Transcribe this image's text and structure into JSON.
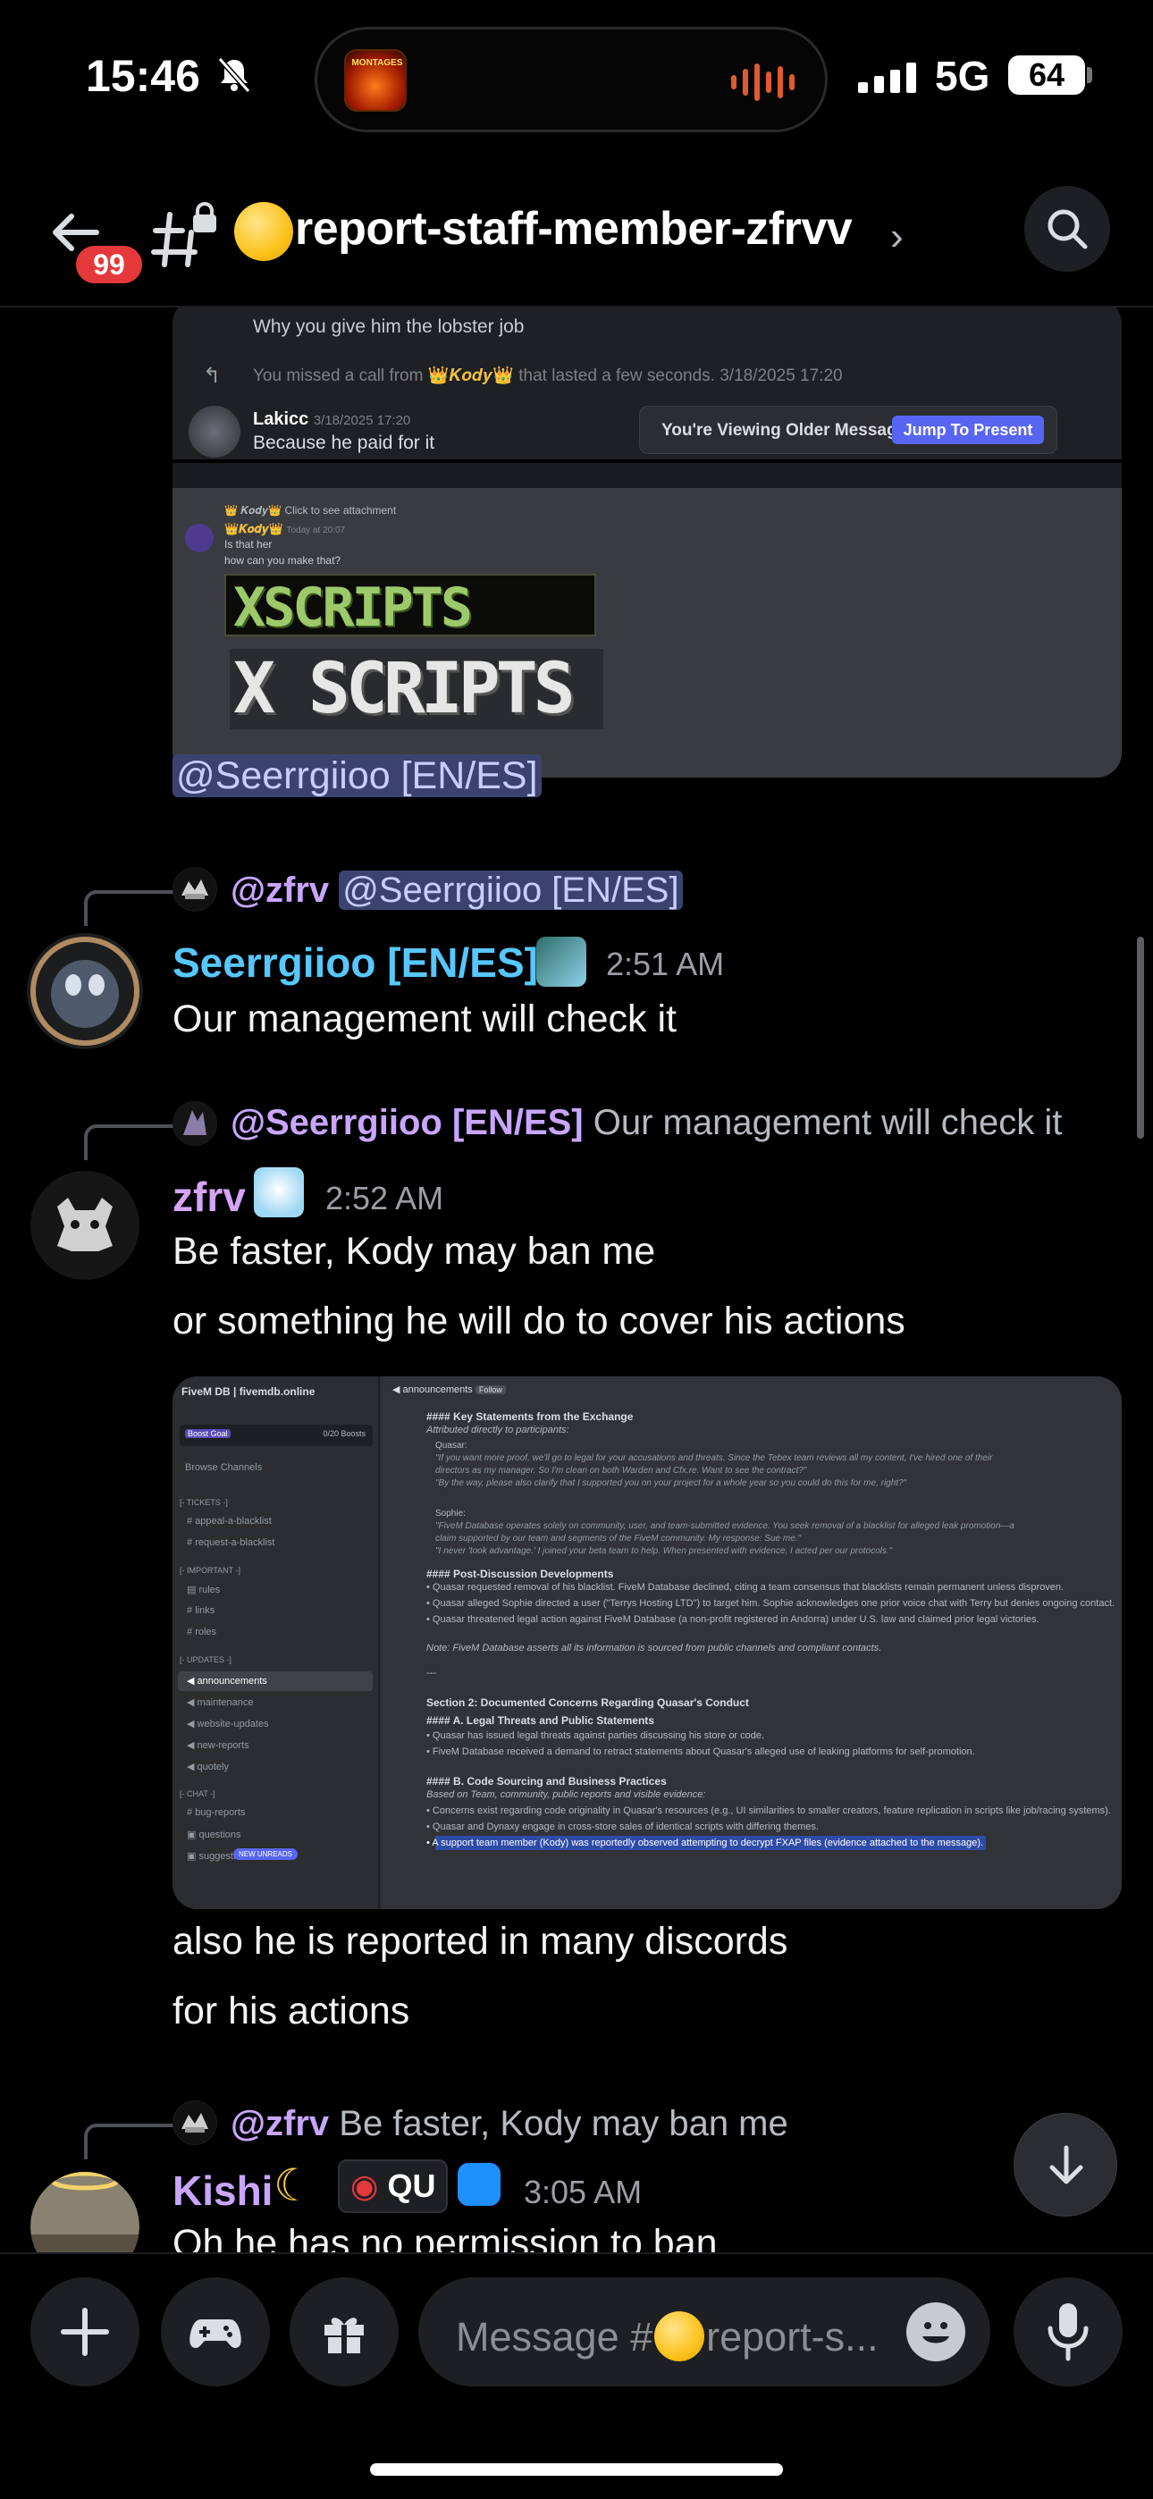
{
  "status_bar": {
    "time": "15:46",
    "network": "5G",
    "battery": "64",
    "island_app_label": "MONTAGES"
  },
  "header": {
    "back_badge": "99",
    "channel_name": "report-staff-member-zfrvv",
    "chevron": "›"
  },
  "attachment_1": {
    "line1": "Why you give him the lobster job",
    "missed_call_pre": "You missed a call from",
    "missed_call_user": "👑𝑲𝒐𝒅𝒚👑",
    "missed_call_post": "that lasted a few seconds. 3/18/2025 17:20",
    "user": "Lakicc",
    "user_time": "3/18/2025 17:20",
    "user_message": "Because he paid for it",
    "older_label": "You're Viewing Older Messages",
    "jump_label": "Jump To Present",
    "reply_header": "👑 𝑲𝒐𝒅𝒚👑 Click to see attachment",
    "kody_name": "👑𝑲𝒐𝒅𝒚👑",
    "kody_time": "Today at 20:07",
    "kody_line1": "Is that her",
    "kody_line2": "how can you make that?",
    "banner1": "XSCRIPTS",
    "banner2": "X SCRIPTS"
  },
  "mention_line": "@Seerrgiioo [EN/ES]",
  "messages": [
    {
      "reply_to_user": "@zfrv",
      "reply_to_text": "@Seerrgiioo [EN/ES]",
      "username": "Seerrgiioo [EN/ES]",
      "username_color": "#57c7ff",
      "time": "2:51 AM",
      "lines": [
        "Our management will check it"
      ]
    },
    {
      "reply_to_user": "@Seerrgiioo [EN/ES]",
      "reply_to_text": "Our management will check it",
      "username": "zfrv",
      "username_color": "#d6a5f5",
      "time": "2:52 AM",
      "lines": [
        "Be faster, Kody may ban me",
        "or something he will do to cover his actions"
      ],
      "after_lines": [
        "also he is reported in many discords",
        "for his actions"
      ]
    },
    {
      "reply_to_user": "@zfrv",
      "reply_to_text": "Be faster, Kody may ban me",
      "username": "Kishi",
      "username_color": "#c8a6ff",
      "tag": "QU",
      "time": "3:05 AM",
      "lines": [
        "Oh he has no permission to ban"
      ]
    }
  ],
  "attachment_2": {
    "server_name": "FiveM DB | fivemdb.online",
    "boost_goal": "Boost Goal",
    "boosts": "0/20 Boosts",
    "browse_channels": "Browse Channels",
    "tickets_cat": "[- TICKETS -]",
    "ch_appeal": "appeal-a-blacklist",
    "ch_request": "request-a-blacklist",
    "important_cat": "[- IMPORTANT -]",
    "ch_rules": "rules",
    "ch_links": "links",
    "ch_roles": "roles",
    "updates_cat": "[- UPDATES -]",
    "ch_announcements": "announcements",
    "ch_maintenance": "maintenance",
    "ch_website": "website-updates",
    "ch_newreports": "new-reports",
    "ch_quotely": "quotely",
    "chat_cat": "[- CHAT -]",
    "ch_bugreports": "bug-reports",
    "ch_questions": "questions",
    "ch_suggestions": "suggestions",
    "new_unreads": "NEW UNREADS",
    "topbar_channel": "announcements",
    "follow": "Follow",
    "h_key": "#### Key Statements from the Exchange",
    "attrib": "Attributed directly to participants:",
    "quasar_label": "Quasar:",
    "quasar_q1": "\"If you want more proof, we'll go to legal for your accusations and threats. Since the Tebex team reviews all my content, I've hired one of their",
    "quasar_q1b": "directors as my manager. So I'm clean on both Warden and Cfx.re. Want to see the contract?\"",
    "quasar_q2": "\"By the way, please also clarify that I supported you on your project for a whole year so you could do this for me, right?\"",
    "sophie_label": "Sophie:",
    "sophie_q1": "\"FiveM Database operates solely on community, user, and team-submitted evidence. You seek removal of a blacklist for alleged leak promotion—a",
    "sophie_q1b": "claim supported by our team and segments of the FiveM community. My response: Sue me.\"",
    "sophie_q2": "\"I never 'took advantage.' I joined your beta team to help. When presented with evidence, I acted per our protocols.\"",
    "h_post": "#### Post-Discussion Developments",
    "post1": "Quasar requested removal of his blacklist. FiveM Database declined, citing a team consensus that blacklists remain permanent unless disproven.",
    "post2": "Quasar alleged Sophie directed a user (\"Terrys Hosting LTD\") to target him. Sophie acknowledges one prior voice chat with Terry but denies ongoing contact.",
    "post3": "Quasar threatened legal action against FiveM Database (a non-profit registered in Andorra) under U.S. law and claimed prior legal victories.",
    "note": "Note: FiveM Database asserts all its information is sourced from public channels and compliant contacts.",
    "divider": "---",
    "section2": "Section 2: Documented Concerns Regarding Quasar's Conduct",
    "h_a": "#### A. Legal Threats and Public Statements",
    "a1": "Quasar has issued legal threats against parties discussing his store or code.",
    "a2": "FiveM Database received a demand to retract statements about Quasar's alleged use of leaking platforms for self-promotion.",
    "h_b": "#### B. Code Sourcing and Business Practices",
    "b_intro": "Based on Team, community, public reports and visible evidence:",
    "b1": "Concerns exist regarding code originality in Quasar's resources (e.g., UI similarities to smaller creators, feature replication in scripts like job/racing systems).",
    "b2": "Quasar and Dynaxy engage in cross-store sales of identical scripts with differing themes.",
    "b3": "A support team member (Kody) was reportedly observed attempting to decrypt FXAP files (evidence attached to the message)."
  },
  "composer": {
    "placeholder_pre": "Message #",
    "placeholder_post": "report-s..."
  },
  "colors": {
    "background": "#000000",
    "mention_bg": "#3c4270",
    "blurple": "#5865f2",
    "badge_red": "#e5383b"
  }
}
